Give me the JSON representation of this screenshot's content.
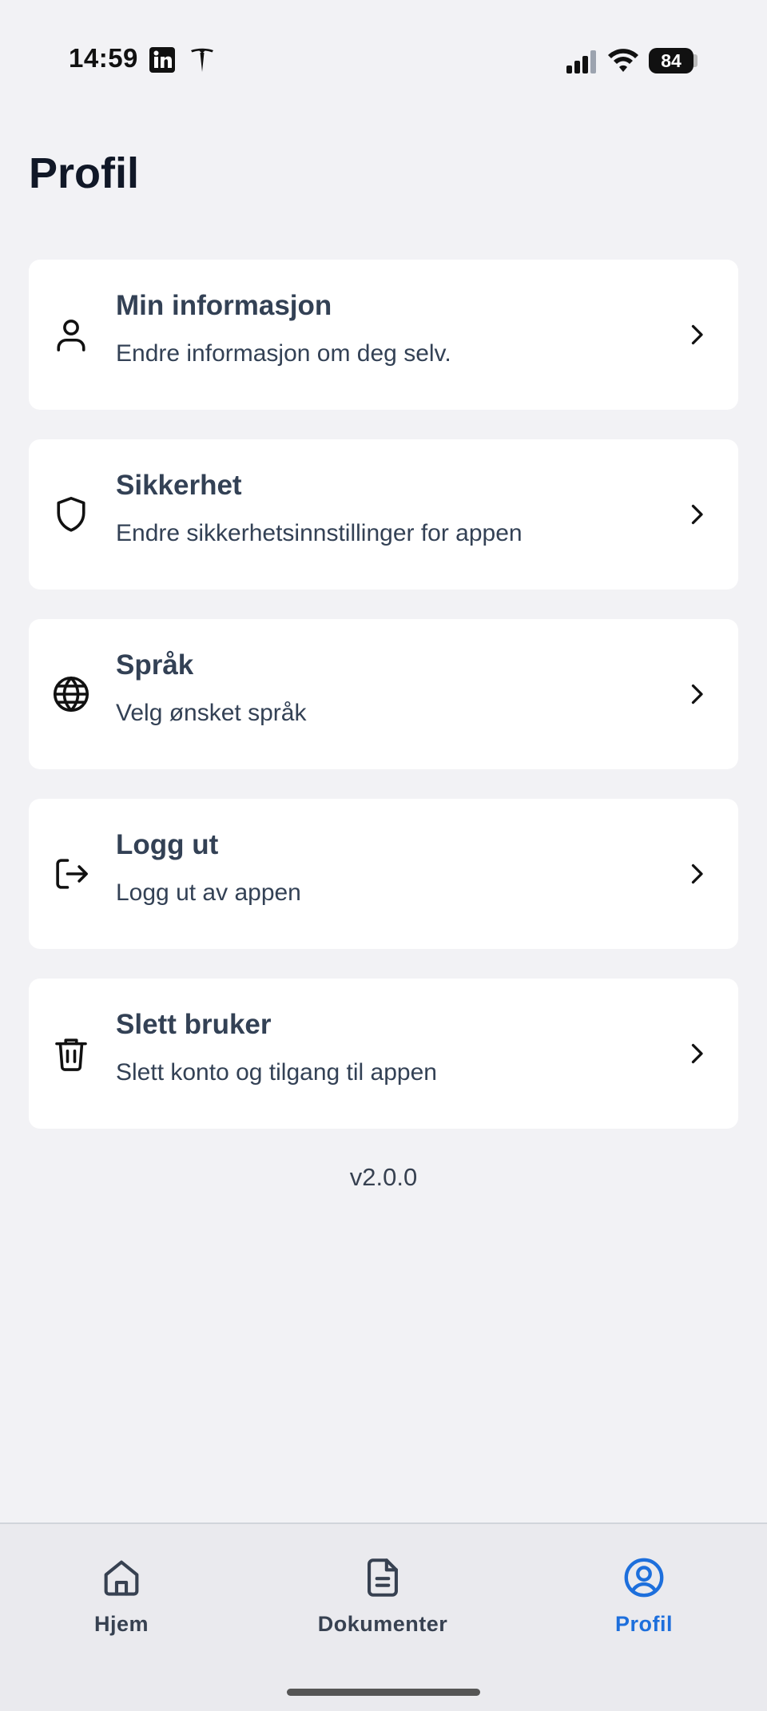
{
  "status_bar": {
    "time": "14:59",
    "battery": "84",
    "icons": [
      "linkedin-icon",
      "tesla-icon",
      "signal-icon",
      "wifi-icon",
      "battery-icon"
    ]
  },
  "page": {
    "title": "Profil"
  },
  "menu": [
    {
      "title": "Min informasjon",
      "subtitle": "Endre informasjon om deg selv.",
      "icon": "user-icon"
    },
    {
      "title": "Sikkerhet",
      "subtitle": "Endre sikkerhetsinnstillinger for appen",
      "icon": "shield-icon"
    },
    {
      "title": "Språk",
      "subtitle": "Velg ønsket språk",
      "icon": "globe-icon"
    },
    {
      "title": "Logg ut",
      "subtitle": "Logg ut av appen",
      "icon": "logout-icon"
    },
    {
      "title": "Slett bruker",
      "subtitle": "Slett konto og tilgang til appen",
      "icon": "trash-icon"
    }
  ],
  "version": "v2.0.0",
  "nav": {
    "items": [
      {
        "label": "Hjem",
        "icon": "home-icon",
        "active": false
      },
      {
        "label": "Dokumenter",
        "icon": "document-icon",
        "active": false
      },
      {
        "label": "Profil",
        "icon": "profile-circle-icon",
        "active": true
      }
    ]
  },
  "colors": {
    "background": "#f2f2f5",
    "card": "#ffffff",
    "text": "#334155",
    "title": "#111827",
    "active": "#1d6fdc",
    "inactive": "#374151"
  }
}
